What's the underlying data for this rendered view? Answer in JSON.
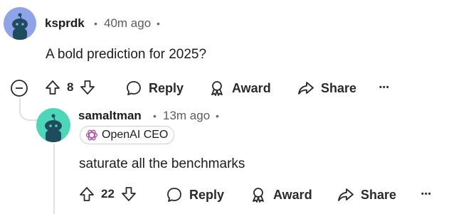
{
  "comment1": {
    "username": "ksprdk",
    "separator": "•",
    "time": "40m ago",
    "trailing_dot": "•",
    "body": "A bold prediction for 2025?",
    "score": "8",
    "actions": {
      "reply": "Reply",
      "award": "Award",
      "share": "Share",
      "more": "•••"
    }
  },
  "comment2": {
    "username": "samaltman",
    "separator": "•",
    "time": "13m ago",
    "trailing_dot": "•",
    "flair": "OpenAI CEO",
    "body": "saturate all the benchmarks",
    "score": "22",
    "actions": {
      "reply": "Reply",
      "award": "Award",
      "share": "Share",
      "more": "•••"
    }
  },
  "colors": {
    "avatar1_bg": "#8ea3e8",
    "avatar2_bg": "#4ed6b8",
    "snoo_body": "#1f4c5c"
  }
}
